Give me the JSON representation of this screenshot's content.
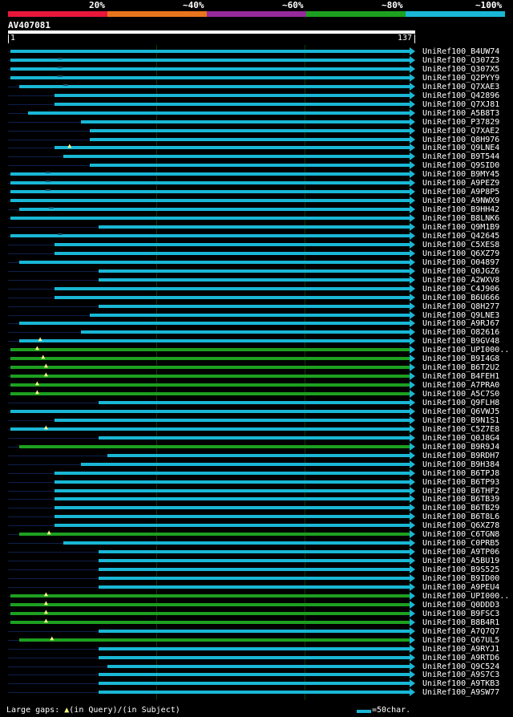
{
  "legend": [
    {
      "label": "20%",
      "color": "#e8173a"
    },
    {
      "label": "~40%",
      "color": "#e8751d"
    },
    {
      "label": "~60%",
      "color": "#952b9b"
    },
    {
      "label": "~80%",
      "color": "#1da020"
    },
    {
      "label": "~100%",
      "color": "#19b7d5"
    }
  ],
  "query": {
    "name": "AV407081",
    "start": "1",
    "end": "137"
  },
  "colors": {
    "cyan": "#19b7d5",
    "green": "#1da020"
  },
  "hits": [
    {
      "name": "UniRef100_B4UW74",
      "start": 1,
      "end": 137,
      "color": "cyan"
    },
    {
      "name": "UniRef100_Q307Z3",
      "start": 1,
      "end": 137,
      "color": "cyan",
      "sgap": 10
    },
    {
      "name": "UniRef100_Q307X5",
      "start": 1,
      "end": 137,
      "color": "cyan",
      "sgap": 10
    },
    {
      "name": "UniRef100_Q2PYY9",
      "start": 1,
      "end": 137,
      "color": "cyan",
      "sgap": 10
    },
    {
      "name": "UniRef100_Q7XAE3",
      "start": 4,
      "end": 137,
      "color": "cyan",
      "sgap": 12
    },
    {
      "name": "UniRef100_Q42896",
      "start": 16,
      "end": 137,
      "color": "cyan"
    },
    {
      "name": "UniRef100_Q7XJ81",
      "start": 16,
      "end": 137,
      "color": "cyan"
    },
    {
      "name": "UniRef100_A5B8T3",
      "start": 7,
      "end": 137,
      "color": "cyan"
    },
    {
      "name": "UniRef100_P37829",
      "start": 25,
      "end": 137,
      "color": "cyan"
    },
    {
      "name": "UniRef100_Q7XAE2",
      "start": 28,
      "end": 137,
      "color": "cyan"
    },
    {
      "name": "UniRef100_Q8H976",
      "start": 28,
      "end": 137,
      "color": "cyan"
    },
    {
      "name": "UniRef100_Q9LNE4",
      "start": 16,
      "end": 137,
      "color": "cyan",
      "qgap": 21
    },
    {
      "name": "UniRef100_B9T544",
      "start": 19,
      "end": 137,
      "color": "cyan"
    },
    {
      "name": "UniRef100_Q9SID0",
      "start": 28,
      "end": 137,
      "color": "cyan"
    },
    {
      "name": "UniRef100_B9MY45",
      "start": 1,
      "end": 137,
      "color": "cyan",
      "sgap": 6
    },
    {
      "name": "UniRef100_A9PEZ9",
      "start": 1,
      "end": 137,
      "color": "cyan",
      "sgap": 6
    },
    {
      "name": "UniRef100_A9P8P5",
      "start": 1,
      "end": 137,
      "color": "cyan",
      "sgap": 6
    },
    {
      "name": "UniRef100_A9NWX9",
      "start": 1,
      "end": 137,
      "color": "cyan"
    },
    {
      "name": "UniRef100_B9HH42",
      "start": 4,
      "end": 137,
      "color": "cyan",
      "sgap": 7
    },
    {
      "name": "UniRef100_B8LNK6",
      "start": 1,
      "end": 137,
      "color": "cyan"
    },
    {
      "name": "UniRef100_Q9M1B9",
      "start": 31,
      "end": 137,
      "color": "cyan"
    },
    {
      "name": "UniRef100_Q42645",
      "start": 1,
      "end": 137,
      "color": "cyan",
      "sgap": 10
    },
    {
      "name": "UniRef100_C5XES8",
      "start": 16,
      "end": 137,
      "color": "cyan"
    },
    {
      "name": "UniRef100_Q6XZ79",
      "start": 16,
      "end": 137,
      "color": "cyan"
    },
    {
      "name": "UniRef100_O04897",
      "start": 4,
      "end": 137,
      "color": "cyan"
    },
    {
      "name": "UniRef100_Q0JGZ6",
      "start": 31,
      "end": 137,
      "color": "cyan"
    },
    {
      "name": "UniRef100_A2WXV8",
      "start": 31,
      "end": 137,
      "color": "cyan"
    },
    {
      "name": "UniRef100_C4J906",
      "start": 16,
      "end": 137,
      "color": "cyan"
    },
    {
      "name": "UniRef100_B6U666",
      "start": 16,
      "end": 137,
      "color": "cyan"
    },
    {
      "name": "UniRef100_Q8H277",
      "start": 31,
      "end": 137,
      "color": "cyan"
    },
    {
      "name": "UniRef100_Q9LNE3",
      "start": 28,
      "end": 137,
      "color": "cyan"
    },
    {
      "name": "UniRef100_A9RJ67",
      "start": 4,
      "end": 137,
      "color": "cyan"
    },
    {
      "name": "UniRef100_O82616",
      "start": 25,
      "end": 137,
      "color": "cyan"
    },
    {
      "name": "UniRef100_B9GV48",
      "start": 4,
      "end": 137,
      "color": "cyan",
      "qgap": 11
    },
    {
      "name": "UniRef100_UPI000..",
      "start": 1,
      "end": 137,
      "color": "green",
      "qgap": 10
    },
    {
      "name": "UniRef100_B9I4G8",
      "start": 1,
      "end": 137,
      "color": "green",
      "qgap": 12
    },
    {
      "name": "UniRef100_B6T2U2",
      "start": 1,
      "end": 137,
      "color": "green",
      "qgap": 13
    },
    {
      "name": "UniRef100_B4FEH1",
      "start": 1,
      "end": 137,
      "color": "green",
      "qgap": 13
    },
    {
      "name": "UniRef100_A7PRA0",
      "start": 1,
      "end": 137,
      "color": "green",
      "qgap": 10
    },
    {
      "name": "UniRef100_A5C7S0",
      "start": 1,
      "end": 137,
      "color": "green",
      "qgap": 10
    },
    {
      "name": "UniRef100_Q9FLH8",
      "start": 31,
      "end": 137,
      "color": "cyan"
    },
    {
      "name": "UniRef100_Q6VWJ5",
      "start": 1,
      "end": 137,
      "color": "cyan"
    },
    {
      "name": "UniRef100_B9N1S1",
      "start": 16,
      "end": 137,
      "color": "cyan"
    },
    {
      "name": "UniRef100_C5Z7E8",
      "start": 1,
      "end": 137,
      "color": "cyan",
      "qgap": 13
    },
    {
      "name": "UniRef100_Q0J8G4",
      "start": 31,
      "end": 137,
      "color": "cyan"
    },
    {
      "name": "UniRef100_B9R9J4",
      "start": 4,
      "end": 137,
      "color": "green"
    },
    {
      "name": "UniRef100_B9RDH7",
      "start": 34,
      "end": 137,
      "color": "cyan"
    },
    {
      "name": "UniRef100_B9H384",
      "start": 25,
      "end": 137,
      "color": "cyan"
    },
    {
      "name": "UniRef100_B6TPJ8",
      "start": 16,
      "end": 137,
      "color": "cyan"
    },
    {
      "name": "UniRef100_B6TP93",
      "start": 16,
      "end": 137,
      "color": "cyan"
    },
    {
      "name": "UniRef100_B6THF2",
      "start": 16,
      "end": 137,
      "color": "cyan"
    },
    {
      "name": "UniRef100_B6TB39",
      "start": 16,
      "end": 137,
      "color": "cyan"
    },
    {
      "name": "UniRef100_B6TB29",
      "start": 16,
      "end": 137,
      "color": "cyan"
    },
    {
      "name": "UniRef100_B6T8L6",
      "start": 16,
      "end": 137,
      "color": "cyan"
    },
    {
      "name": "UniRef100_Q6XZ78",
      "start": 16,
      "end": 137,
      "color": "cyan"
    },
    {
      "name": "UniRef100_C6TGN8",
      "start": 4,
      "end": 137,
      "color": "green",
      "qgap": 14
    },
    {
      "name": "UniRef100_C0PRB5",
      "start": 19,
      "end": 137,
      "color": "cyan"
    },
    {
      "name": "UniRef100_A9TP06",
      "start": 31,
      "end": 137,
      "color": "cyan"
    },
    {
      "name": "UniRef100_A5BU19",
      "start": 31,
      "end": 137,
      "color": "cyan"
    },
    {
      "name": "UniRef100_B9S525",
      "start": 31,
      "end": 137,
      "color": "cyan"
    },
    {
      "name": "UniRef100_B9ID00",
      "start": 31,
      "end": 137,
      "color": "cyan"
    },
    {
      "name": "UniRef100_A9PEU4",
      "start": 31,
      "end": 137,
      "color": "cyan"
    },
    {
      "name": "UniRef100_UPI000..",
      "start": 1,
      "end": 137,
      "color": "green",
      "qgap": 13
    },
    {
      "name": "UniRef100_Q0DDD3",
      "start": 1,
      "end": 137,
      "color": "green",
      "qgap": 13
    },
    {
      "name": "UniRef100_B9FSC3",
      "start": 1,
      "end": 137,
      "color": "green",
      "qgap": 13
    },
    {
      "name": "UniRef100_B8B4R1",
      "start": 1,
      "end": 137,
      "color": "green",
      "qgap": 13
    },
    {
      "name": "UniRef100_A7Q7Q7",
      "start": 31,
      "end": 137,
      "color": "cyan"
    },
    {
      "name": "UniRef100_Q67UL5",
      "start": 4,
      "end": 137,
      "color": "green",
      "qgap": 15
    },
    {
      "name": "UniRef100_A9RYJ1",
      "start": 31,
      "end": 137,
      "color": "cyan"
    },
    {
      "name": "UniRef100_A9RTD6",
      "start": 31,
      "end": 137,
      "color": "cyan"
    },
    {
      "name": "UniRef100_Q9C524",
      "start": 34,
      "end": 137,
      "color": "cyan"
    },
    {
      "name": "UniRef100_A9S7C3",
      "start": 31,
      "end": 137,
      "color": "cyan"
    },
    {
      "name": "UniRef100_A9TKB3",
      "start": 31,
      "end": 137,
      "color": "cyan"
    },
    {
      "name": "UniRef100_A9SW77",
      "start": 31,
      "end": 137,
      "color": "cyan"
    }
  ],
  "footer": {
    "gaps_prefix": "Large gaps: ",
    "gaps_query": "(in Query)/",
    "gaps_subject": "(in Subject)",
    "scale": "=50char."
  }
}
